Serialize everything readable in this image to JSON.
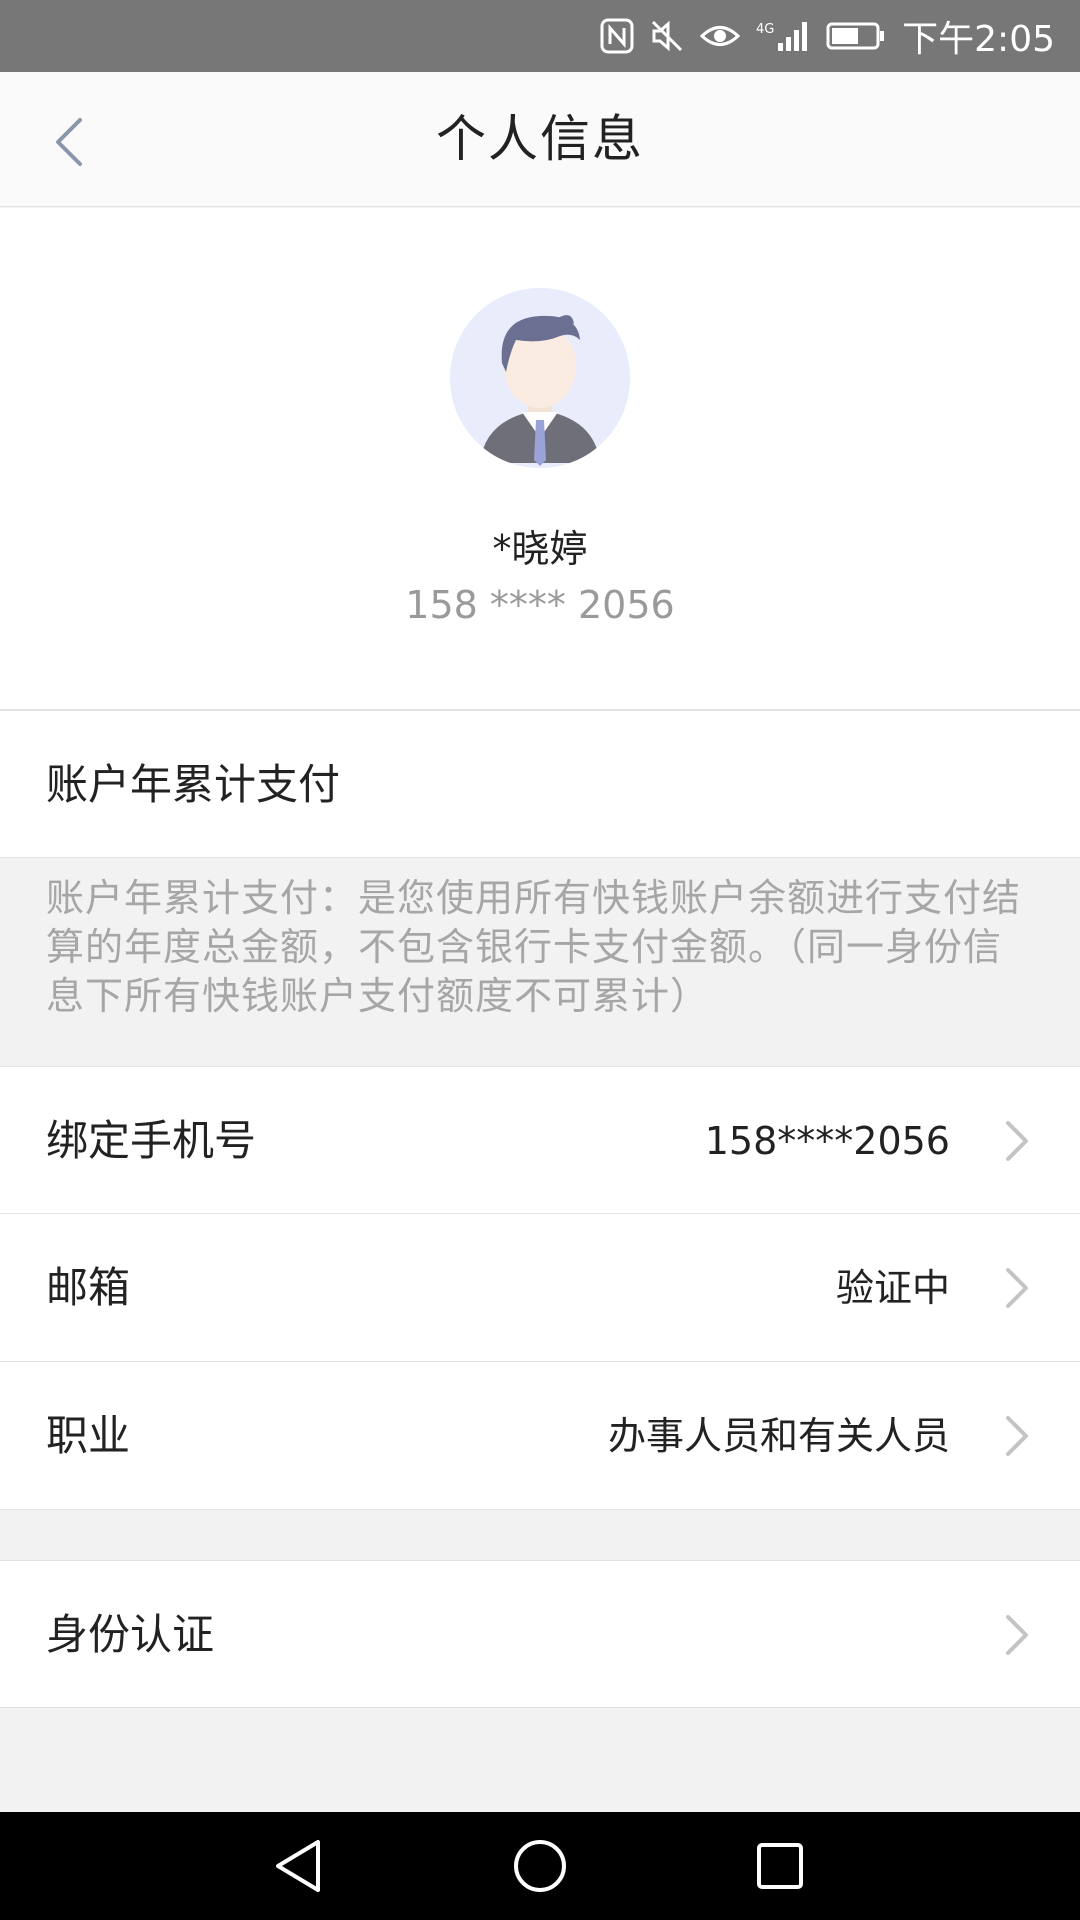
{
  "status_bar": {
    "time": "下午2:05",
    "icons": [
      "nfc-icon",
      "mute-icon",
      "eye-icon",
      "signal-4g-icon",
      "battery-icon"
    ]
  },
  "nav": {
    "title": "个人信息",
    "back_icon": "chevron-left-icon"
  },
  "profile": {
    "name": "*晓婷",
    "phone": "158 **** 2056",
    "avatar_icon": "default-avatar-icon"
  },
  "annual_payment": {
    "label": "账户年累计支付",
    "description": "账户年累计支付：是您使用所有快钱账户余额进行支付结算的年度总金额，不包含银行卡支付金额。（同一身份信息下所有快钱账户支付额度不可累计）"
  },
  "settings": [
    {
      "label": "绑定手机号",
      "value": "158****2056"
    },
    {
      "label": "邮箱",
      "value": "验证中"
    },
    {
      "label": "职业",
      "value": "办事人员和有关人员"
    }
  ],
  "identity": {
    "label": "身份认证"
  },
  "system_nav": {
    "icons": [
      "back-triangle-icon",
      "home-circle-icon",
      "recents-square-icon"
    ]
  },
  "colors": {
    "status_bar": "#777777",
    "background": "#f2f2f2",
    "secondary_text": "#9a9a9a",
    "chevron": "#c4c4c4"
  }
}
